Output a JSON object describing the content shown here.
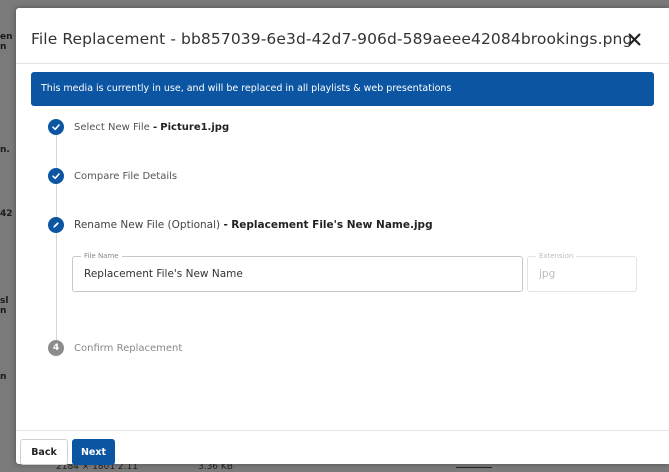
{
  "dialog": {
    "title": "File Replacement - bb857039-6e3d-42d7-906d-589aeee42084brookings.png",
    "close_icon": "close-icon",
    "banner": "This media is currently in use, and will be replaced in all playlists & web presentations"
  },
  "steps": [
    {
      "state": "completed",
      "icon": "check-icon",
      "label": "Select New File",
      "separator": "-",
      "detail": "Picture1.jpg"
    },
    {
      "state": "completed",
      "icon": "check-icon",
      "label": "Compare File Details"
    },
    {
      "state": "active",
      "icon": "pencil-icon",
      "label": "Rename New File (Optional)",
      "separator": "-",
      "detail": "Replacement File's New Name.jpg"
    },
    {
      "state": "pending",
      "number": "4",
      "label": "Confirm Replacement"
    }
  ],
  "fields": {
    "file_name": {
      "label": "File Name",
      "value": "Replacement File's New Name"
    },
    "extension": {
      "label": "Extension",
      "value": "jpg"
    }
  },
  "footer": {
    "back_label": "Back",
    "next_label": "Next"
  },
  "background": {
    "fragments": [
      "en",
      "n",
      "n.",
      "42",
      "sl",
      "n",
      "n"
    ],
    "bottom_values": [
      "2184 × 1801 2.11",
      "3.36 KB"
    ]
  },
  "colors": {
    "primary": "#0b55a3",
    "pending_step": "#8c8c8c",
    "overlay": "#7a7a7a"
  }
}
